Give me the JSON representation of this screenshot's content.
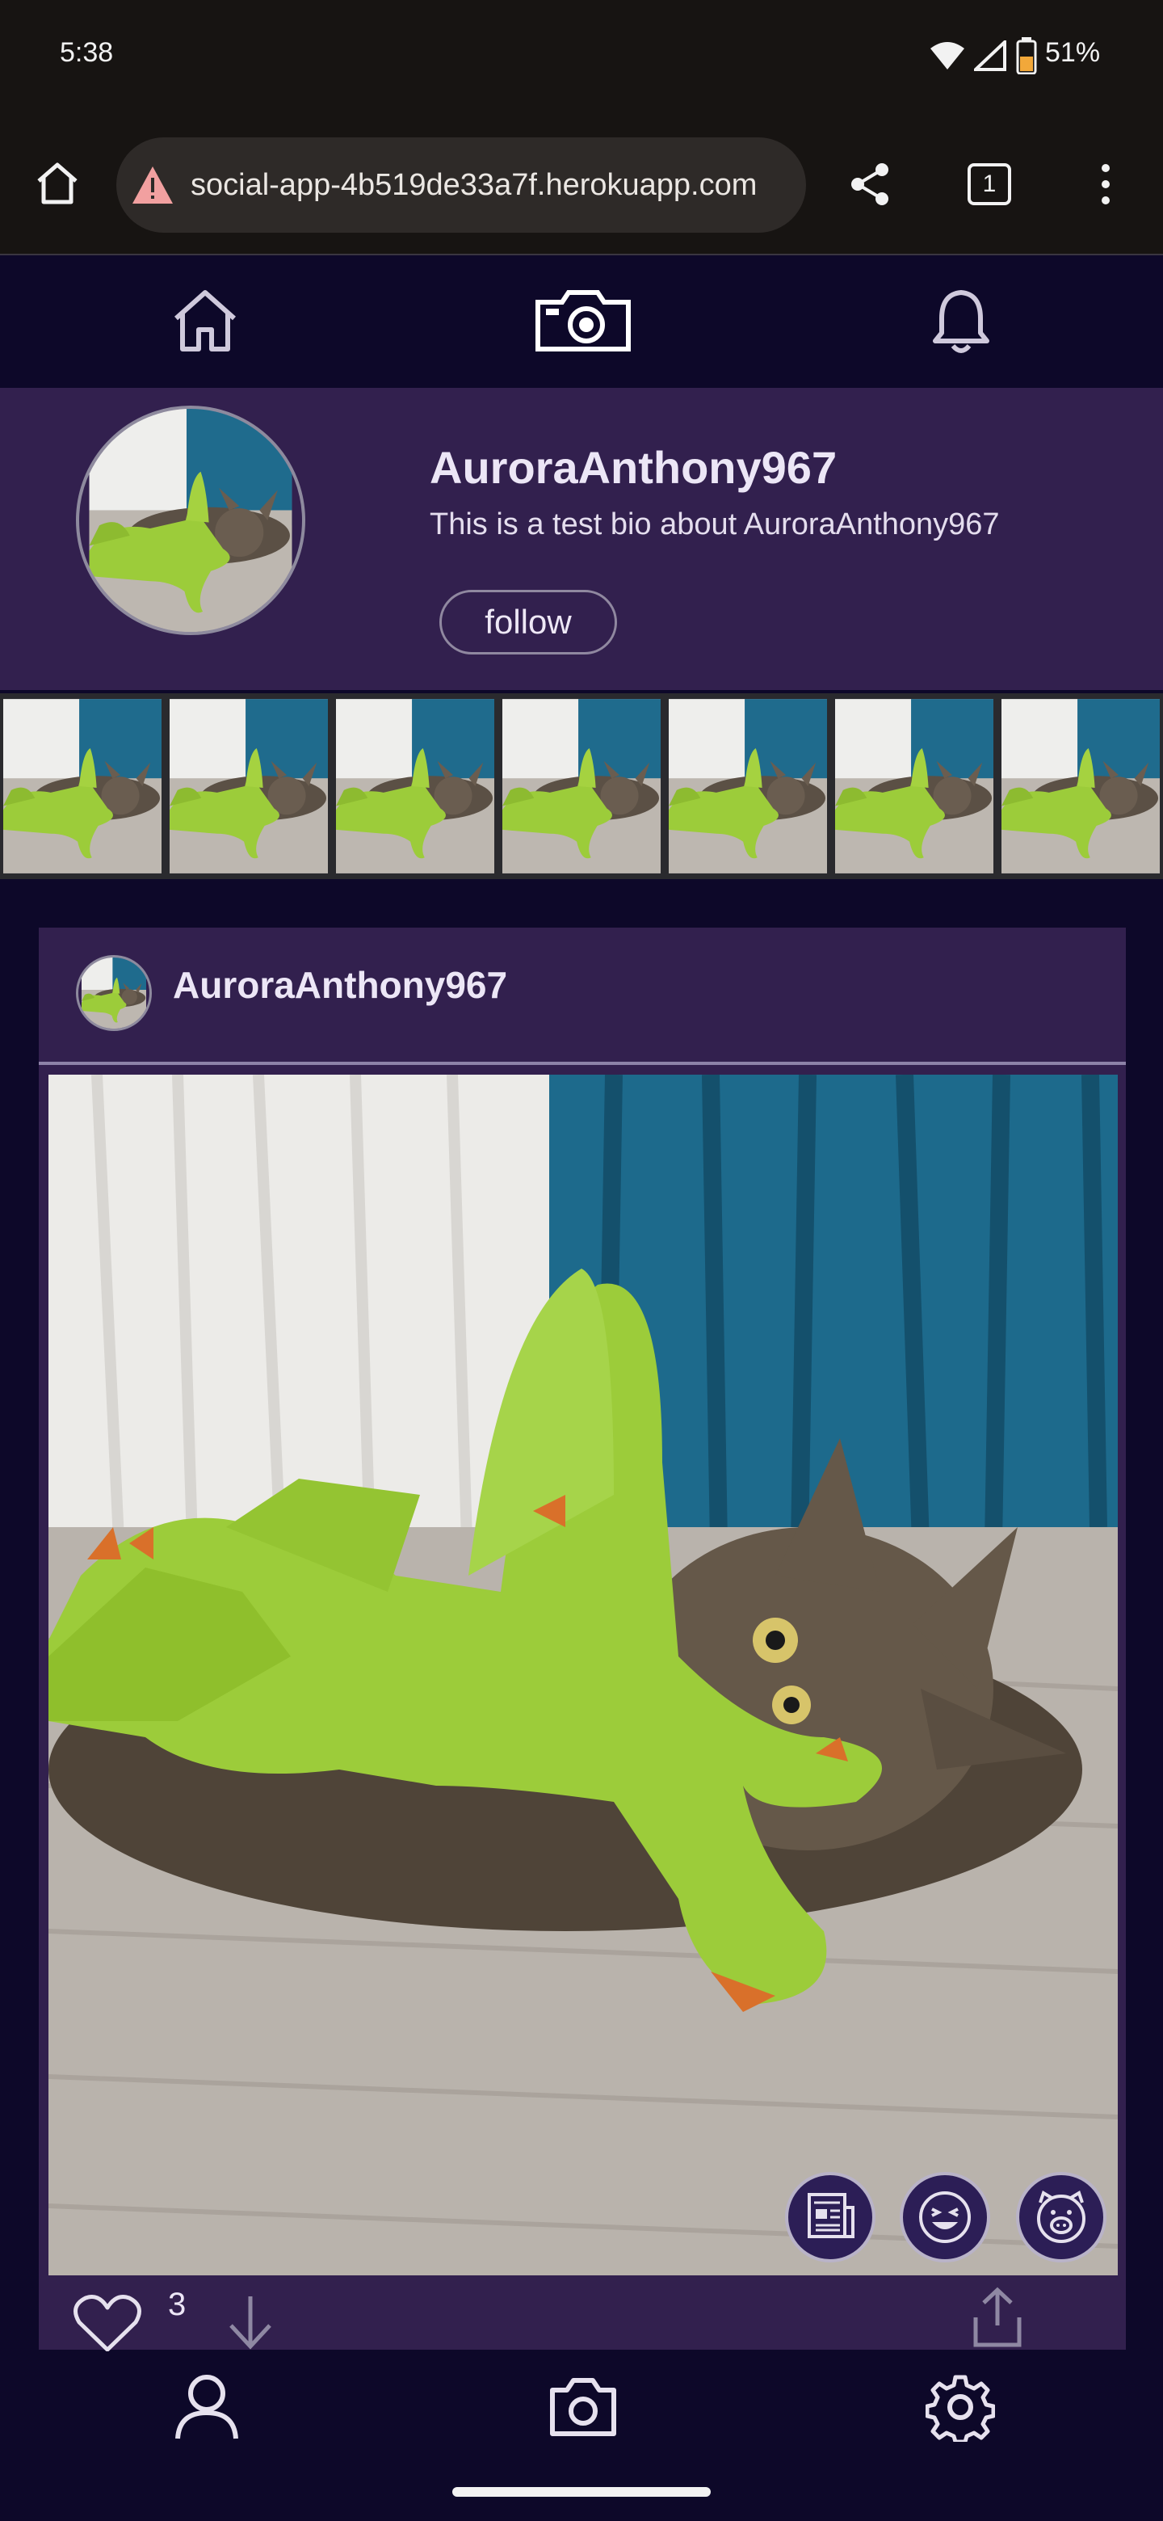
{
  "status_bar": {
    "time": "5:38",
    "battery": "51%"
  },
  "browser": {
    "url": "social-app-4b519de33a7f.herokuapp.com",
    "tab_count": "1"
  },
  "profile": {
    "username": "AuroraAnthony967",
    "bio": "This is a test bio about AuroraAnthony967",
    "follow_label": "follow"
  },
  "post": {
    "author": "AuroraAnthony967",
    "like_count": "3"
  },
  "icons": {
    "top_nav": [
      "home-icon",
      "camera-icon",
      "bell-icon"
    ],
    "bottom_nav": [
      "profile-icon",
      "camera-icon",
      "settings-icon"
    ],
    "reactions": [
      "news-reaction-icon",
      "laughing-reaction-icon",
      "pig-reaction-icon"
    ]
  },
  "colors": {
    "background": "#0d0829",
    "card": "#32204e",
    "text": "#ece6f6"
  }
}
